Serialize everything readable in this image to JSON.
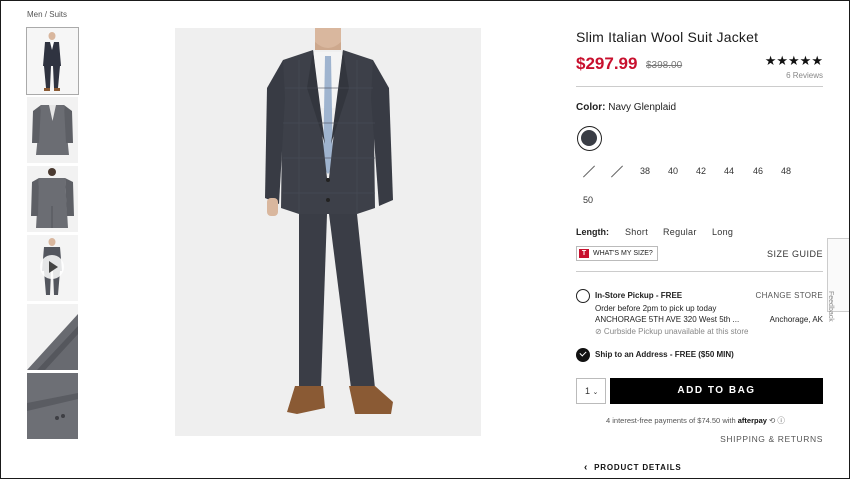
{
  "breadcrumb": "Men / Suits",
  "product": {
    "title": "Slim Italian Wool Suit Jacket",
    "price": "$297.99",
    "original_price": "$398.00",
    "rating_stars": "★★★★★",
    "reviews": "6 Reviews",
    "color_label": "Color:",
    "color_value": "Navy Glenplaid"
  },
  "sizes": [
    "38",
    "40",
    "42",
    "44",
    "46",
    "48",
    "50"
  ],
  "length": {
    "label": "Length:",
    "options": [
      "Short",
      "Regular",
      "Long"
    ]
  },
  "whats_my_size": "WHAT'S MY SIZE?",
  "whats_my_size_icon": "T",
  "size_guide": "SIZE GUIDE",
  "pickup": {
    "title": "In-Store Pickup - FREE",
    "line1": "Order before 2pm to pick up today",
    "store": "ANCHORAGE 5TH AVE 320 West 5th ...",
    "city": "Anchorage, AK",
    "curbside": "⊘ Curbside Pickup unavailable at this store",
    "change": "CHANGE STORE"
  },
  "ship": {
    "title": "Ship to an Address - FREE ($50 MIN)"
  },
  "quantity": "1",
  "add_to_bag": "ADD TO BAG",
  "afterpay": {
    "text": "4 interest-free payments of $74.50 with",
    "brand": "afterpay",
    "symbol": "⟲ ⓘ"
  },
  "shipping_returns": "SHIPPING & RETURNS",
  "product_details": "PRODUCT DETAILS",
  "feedback": "Feedback",
  "colors": {
    "price_red": "#c8102e",
    "swatch": "#3a3d45",
    "suit": "#3d4049",
    "shoe": "#8a5a34"
  }
}
